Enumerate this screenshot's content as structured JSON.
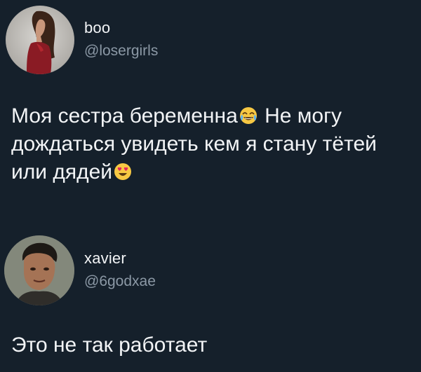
{
  "tweets": [
    {
      "display_name": "boo",
      "handle": "@losergirls",
      "text_parts": [
        "Моя сестра беременна",
        "Не могу дождаться увидеть кем я стану тётей или дядей"
      ],
      "emojis": [
        "crying-laughing-emoji",
        "heart-eyes-emoji"
      ]
    },
    {
      "display_name": "xavier",
      "handle": "@6godxae",
      "text": "Это не так работает"
    }
  ],
  "colors": {
    "background": "#15202b",
    "text": "#f2f4f6",
    "handle": "#8b98a5"
  }
}
